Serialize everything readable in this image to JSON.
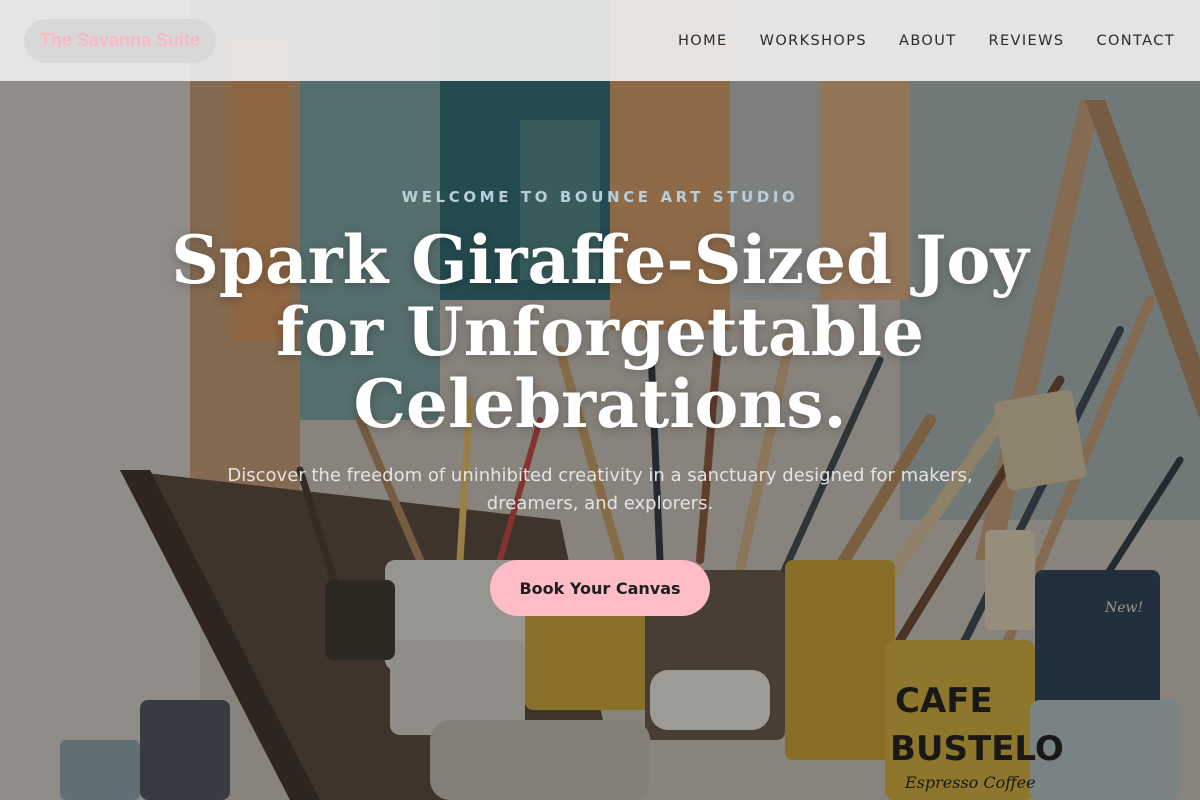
{
  "header": {
    "brand": "The Savanna Suite",
    "nav": [
      {
        "label": "HOME"
      },
      {
        "label": "WORKSHOPS"
      },
      {
        "label": "ABOUT"
      },
      {
        "label": "REVIEWS"
      },
      {
        "label": "CONTACT"
      }
    ]
  },
  "hero": {
    "eyebrow": "WELCOME TO BOUNCE ART STUDIO",
    "title": "Spark Giraffe-Sized Joy for Unforgettable Celebrations.",
    "subtitle": "Discover the freedom of uninhibited creativity in a sanctuary designed for makers, dreamers, and explorers.",
    "cta_label": "Book Your Canvas",
    "background_image": "art-studio-paint-brushes-photo",
    "can_labels": {
      "cafe": "CAFE",
      "bustelo": "BUSTELO",
      "espresso": "Espresso Coffee",
      "new": "New!"
    }
  },
  "colors": {
    "accent_pink": "#fdbcc6",
    "brand_text": "#f8b8c4",
    "eyebrow_blue": "#b7cedb",
    "header_bg": "#ececec"
  }
}
